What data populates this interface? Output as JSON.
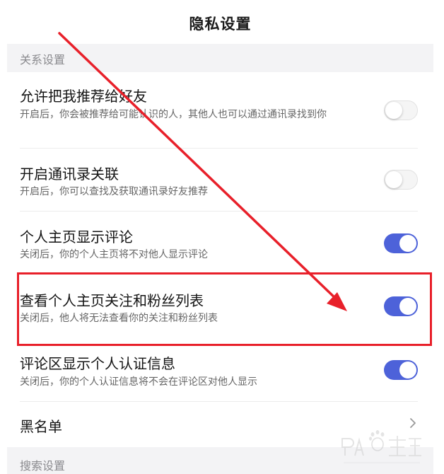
{
  "header": {
    "title": "隐私设置"
  },
  "sections": [
    {
      "label": "关系设置"
    },
    {
      "label": "搜索设置"
    }
  ],
  "settings": [
    {
      "title": "允许把我推荐给好友",
      "desc": "开启后，你会被推荐给可能认识的人，其他人也可以通过通讯录找到你",
      "enabled": false
    },
    {
      "title": "开启通讯录关联",
      "desc": "开启后，你可以查找及获取通讯录好友推荐",
      "enabled": false
    },
    {
      "title": "个人主页显示评论",
      "desc": "关闭后，你的个人主页将不对他人显示评论",
      "enabled": true
    },
    {
      "title": "查看个人主页关注和粉丝列表",
      "desc": "关闭后，他人将无法查看你的关注和粉丝列表",
      "enabled": true
    },
    {
      "title": "评论区显示个人认证信息",
      "desc": "关闭后，你的个人认证信息将不会在评论区对他人显示",
      "enabled": true
    }
  ],
  "blacklist": {
    "title": "黑名单",
    "icon": "chevron-right-icon"
  },
  "overlay": {
    "highlight_color": "#e8202a",
    "arrow_color": "#e8202a",
    "watermark_icon": "baidu-jingyan-watermark"
  },
  "colors": {
    "toggle_on": "#4d62d9",
    "toggle_off": "#f5f5f5",
    "section_bg": "#f3f3f5"
  }
}
